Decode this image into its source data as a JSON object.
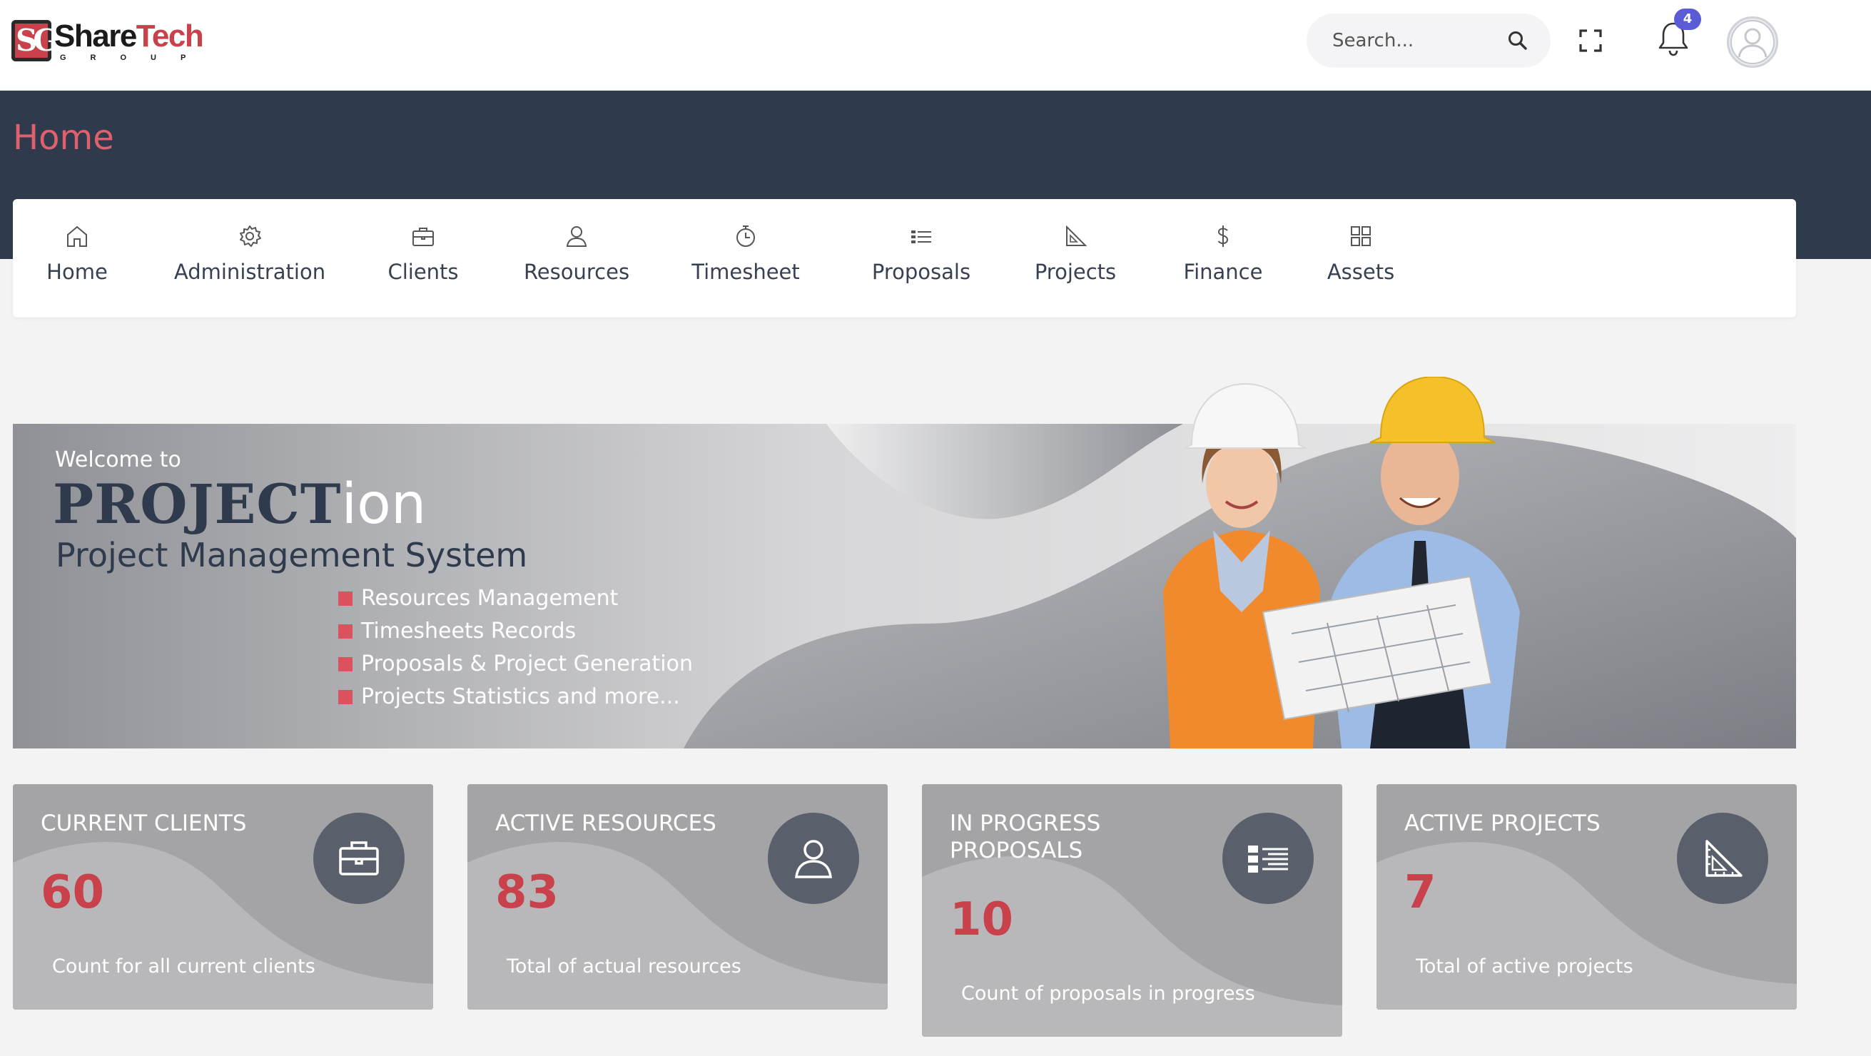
{
  "logo": {
    "brand_part1": "Share",
    "brand_part2": "Tech",
    "sub": "GROUP"
  },
  "search": {
    "placeholder": "Search..."
  },
  "notifications": {
    "count": "4"
  },
  "page": {
    "title": "Home"
  },
  "nav": {
    "items": [
      {
        "label": "Home",
        "icon": "home-icon"
      },
      {
        "label": "Administration",
        "icon": "gear-icon"
      },
      {
        "label": "Clients",
        "icon": "briefcase-icon"
      },
      {
        "label": "Resources",
        "icon": "user-icon"
      },
      {
        "label": "Timesheet",
        "icon": "stopwatch-icon"
      },
      {
        "label": "Proposals",
        "icon": "list-icon"
      },
      {
        "label": "Projects",
        "icon": "set-square-icon"
      },
      {
        "label": "Finance",
        "icon": "dollar-icon"
      },
      {
        "label": "Assets",
        "icon": "grid-icon"
      }
    ]
  },
  "banner": {
    "welcome": "Welcome to",
    "brand_main": "PROJECT",
    "brand_suffix": "ion",
    "subtitle": "Project Management System",
    "features": [
      "Resources Management",
      "Timesheets Records",
      "Proposals & Project Generation",
      "Projects Statistics and more..."
    ]
  },
  "cards": [
    {
      "title": "CURRENT CLIENTS",
      "value": "60",
      "desc": "Count for all current clients",
      "icon": "briefcase-icon"
    },
    {
      "title": "ACTIVE RESOURCES",
      "value": "83",
      "desc": "Total of actual resources",
      "icon": "user-icon"
    },
    {
      "title": "IN PROGRESS PROPOSALS",
      "value": "10",
      "desc": "Count of proposals in progress",
      "icon": "list-icon"
    },
    {
      "title": "ACTIVE PROJECTS",
      "value": "7",
      "desc": "Total of active projects",
      "icon": "set-square-icon"
    }
  ],
  "colors": {
    "accent": "#c9414b",
    "header_band": "#2f3b4c",
    "title_pink": "#e0616d",
    "card_gray": "#a6a6a8"
  }
}
